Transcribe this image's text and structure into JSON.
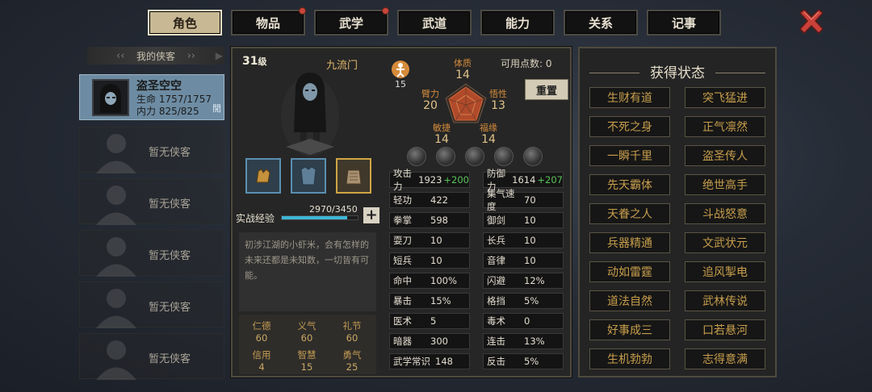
{
  "tabs": [
    {
      "label": "角色",
      "active": true,
      "badge": false
    },
    {
      "label": "物品",
      "active": false,
      "badge": true
    },
    {
      "label": "武学",
      "active": false,
      "badge": true
    },
    {
      "label": "武道",
      "active": false,
      "badge": false
    },
    {
      "label": "能力",
      "active": false,
      "badge": false
    },
    {
      "label": "关系",
      "active": false,
      "badge": false
    },
    {
      "label": "记事",
      "active": false,
      "badge": false
    }
  ],
  "list": {
    "header": "我的侠客",
    "selected": {
      "name": "盗圣空空",
      "hp_label": "生命",
      "hp": "1757/1757",
      "mp_label": "内力",
      "mp": "825/825",
      "tag": "閒"
    },
    "empty_label": "暂无侠客"
  },
  "character": {
    "level": "31",
    "level_unit": "级",
    "sect": "九流门",
    "counter": "15",
    "exp_label": "实战经验",
    "exp": "2970/3450",
    "exp_fraction": 0.86,
    "description": "初涉江湖的小虾米，会有怎样的未来还都是未知数，一切皆有可能。",
    "virtues": [
      {
        "name": "仁德",
        "value": "60"
      },
      {
        "name": "义气",
        "value": "60"
      },
      {
        "name": "礼节",
        "value": "60"
      },
      {
        "name": "信用",
        "value": "4"
      },
      {
        "name": "智慧",
        "value": "15"
      },
      {
        "name": "勇气",
        "value": "25"
      }
    ]
  },
  "attributes": {
    "points_label": "可用点数:",
    "points": "0",
    "reset_label": "重置",
    "items": [
      {
        "name": "体质",
        "value": "14"
      },
      {
        "name": "臂力",
        "value": "20"
      },
      {
        "name": "悟性",
        "value": "13"
      },
      {
        "name": "敏捷",
        "value": "14"
      },
      {
        "name": "福缘",
        "value": "14"
      }
    ]
  },
  "stats": [
    {
      "name": "攻击力",
      "value": "1923",
      "bonus": "+200"
    },
    {
      "name": "防御力",
      "value": "1614",
      "bonus": "+207"
    },
    {
      "name": "轻功",
      "value": "422",
      "bonus": ""
    },
    {
      "name": "集气速度",
      "value": "70",
      "bonus": ""
    },
    {
      "name": "拳掌",
      "value": "598",
      "bonus": ""
    },
    {
      "name": "御剑",
      "value": "10",
      "bonus": ""
    },
    {
      "name": "耍刀",
      "value": "10",
      "bonus": ""
    },
    {
      "name": "长兵",
      "value": "10",
      "bonus": ""
    },
    {
      "name": "短兵",
      "value": "10",
      "bonus": ""
    },
    {
      "name": "音律",
      "value": "10",
      "bonus": ""
    },
    {
      "name": "命中",
      "value": "100%",
      "bonus": ""
    },
    {
      "name": "闪避",
      "value": "12%",
      "bonus": ""
    },
    {
      "name": "暴击",
      "value": "15%",
      "bonus": ""
    },
    {
      "name": "格挡",
      "value": "5%",
      "bonus": ""
    },
    {
      "name": "医术",
      "value": "5",
      "bonus": ""
    },
    {
      "name": "毒术",
      "value": "0",
      "bonus": ""
    },
    {
      "name": "暗器",
      "value": "300",
      "bonus": ""
    },
    {
      "name": "连击",
      "value": "13%",
      "bonus": ""
    },
    {
      "name": "武学常识",
      "value": "148",
      "bonus": ""
    },
    {
      "name": "反击",
      "value": "5%",
      "bonus": ""
    }
  ],
  "status": {
    "title": "获得状态",
    "buffs": [
      "生财有道",
      "突飞猛进",
      "不死之身",
      "正气凛然",
      "一瞬千里",
      "盗圣传人",
      "先天霸体",
      "绝世高手",
      "天眷之人",
      "斗战怒意",
      "兵器精通",
      "文武状元",
      "动如雷霆",
      "追风掣电",
      "道法自然",
      "武林传说",
      "好事成三",
      "口若悬河",
      "生机勃勃",
      "志得意满"
    ]
  },
  "colors": {
    "accent": "#c8b994",
    "buff_text": "#c79e4c",
    "bonus": "#5ac45a",
    "exp": "#3fb6d4",
    "close": "#c9413a"
  }
}
